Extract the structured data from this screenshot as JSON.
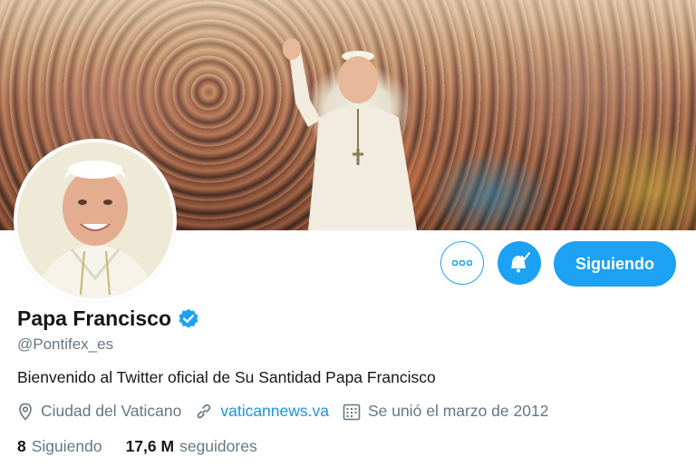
{
  "profile": {
    "name": "Papa Francisco",
    "handle": "@Pontifex_es",
    "bio": "Bienvenido al Twitter oficial de Su Santidad Papa Francisco",
    "location": "Ciudad del Vaticano",
    "website": "vaticannews.va",
    "joined": "Se unió el marzo de 2012",
    "verified": true
  },
  "actions": {
    "more_icon": "more-dots-icon",
    "notifications_icon": "bell-check-icon",
    "follow_label": "Siguiendo"
  },
  "stats": {
    "following_count": "8",
    "following_label": "Siguiendo",
    "followers_count": "17,6 M",
    "followers_label": "seguidores"
  },
  "colors": {
    "accent": "#1da1f2",
    "link": "#1b95e0",
    "secondary_text": "#657786",
    "primary_text": "#14171a"
  }
}
